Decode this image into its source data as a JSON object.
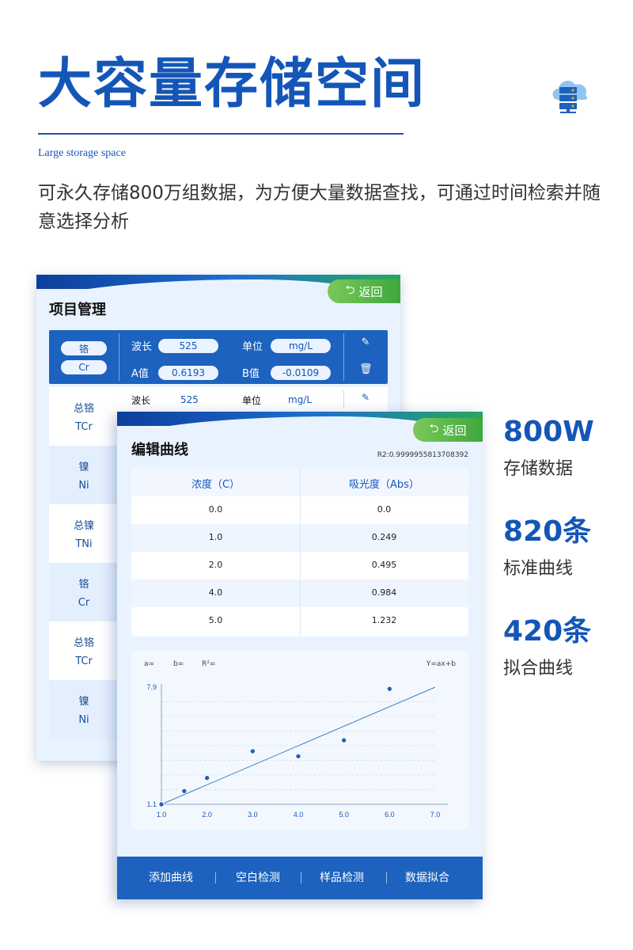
{
  "hero": {
    "title": "大容量存储空间",
    "subtitle": "Large storage space",
    "description": "可永久存储800万组数据，为方便大量数据查找，可通过时间检索并随意选择分析"
  },
  "project_panel": {
    "back_label": "返回",
    "title": "项目管理",
    "selected": {
      "element_name": "铬",
      "element_symbol": "Cr",
      "wavelength_label": "波长",
      "wavelength_value": "525",
      "unit_label": "单位",
      "unit_value": "mg/L",
      "a_label": "A值",
      "a_value": "0.6193",
      "b_label": "B值",
      "b_value": "-0.0109"
    },
    "row": {
      "wavelength_label": "波长",
      "wavelength_value": "525",
      "unit_label": "单位",
      "unit_value": "mg/L"
    },
    "items": [
      {
        "name": "总铬",
        "symbol": "TCr"
      },
      {
        "name": "镍",
        "symbol": "Ni"
      },
      {
        "name": "总镍",
        "symbol": "TNi"
      },
      {
        "name": "铬",
        "symbol": "Cr"
      },
      {
        "name": "总铬",
        "symbol": "TCr"
      },
      {
        "name": "镍",
        "symbol": "Ni"
      }
    ]
  },
  "curve_panel": {
    "back_label": "返回",
    "title": "编辑曲线",
    "r2": "R2:0.9999955813708392",
    "table": {
      "headers": [
        "浓度（C）",
        "吸光度（Abs）"
      ],
      "rows": [
        [
          "0.0",
          "0.0"
        ],
        [
          "1.0",
          "0.249"
        ],
        [
          "2.0",
          "0.495"
        ],
        [
          "4.0",
          "0.984"
        ],
        [
          "5.0",
          "1.232"
        ]
      ]
    },
    "bottom_buttons": [
      "添加曲线",
      "空白检测",
      "样品检测",
      "数据拟合"
    ]
  },
  "chart_data": {
    "type": "scatter",
    "labels": {
      "a": "a=",
      "b": "b=",
      "r2": "R²=",
      "formula": "Y=ax+b"
    },
    "x": [
      1.0,
      1.5,
      2.0,
      3.0,
      4.0,
      5.0,
      6.0
    ],
    "y": [
      1.1,
      1.87,
      2.63,
      4.18,
      3.89,
      4.82,
      7.8
    ],
    "x_ticks": [
      "1.0",
      "2.0",
      "3.0",
      "4.0",
      "5.0",
      "6.0",
      "7.0"
    ],
    "xlim": [
      1.0,
      7.0
    ],
    "y_ticks": [
      "1.1",
      "7.9"
    ],
    "ylim": [
      1.1,
      7.9
    ],
    "fit_line": {
      "x": [
        1.0,
        7.0
      ],
      "y": [
        1.1,
        7.9
      ]
    },
    "grid": true
  },
  "stats": [
    {
      "value": "800W",
      "label": "存储数据"
    },
    {
      "value": "820条",
      "label": "标准曲线"
    },
    {
      "value": "420条",
      "label": "拟合曲线"
    }
  ],
  "colors": {
    "primary": "#1456b8",
    "bar": "#1c62be",
    "accent_green": "#3ea83c",
    "panel_bg": "#e9f3ff"
  }
}
